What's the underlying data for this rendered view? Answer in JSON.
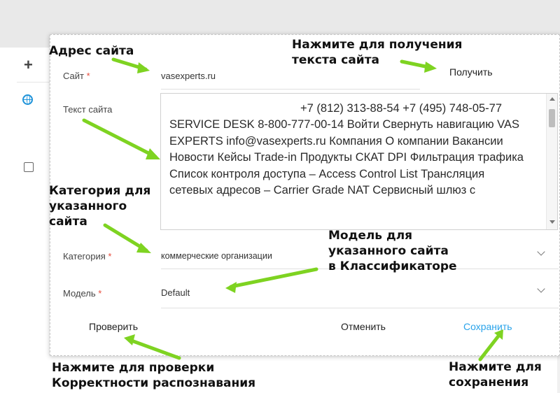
{
  "dialog": {
    "site_label": "Сайт",
    "site_value": "vasexperts.ru",
    "get_button": "Получить",
    "text_label": "Текст сайта",
    "text_content": "+7 (812) 313-88-54 +7 (495) 748-05-77 SERVICE DESK 8-800-777-00-14 Войти Свернуть навигацию VAS EXPERTS info@vasexperts.ru Компания О компании Вакансии Новости Кейсы Trade-in Продукты СКАТ DPI Фильтрация трафика Список контроля доступа – Access Control List Трансляция сетевых адресов – Carrier Grade NAT Сервисный шлюз с",
    "category_label": "Категория",
    "category_value": "коммерческие организации",
    "model_label": "Модель",
    "model_value": "Default",
    "required_mark": "*",
    "check_button": "Проверить",
    "cancel_button": "Отменить",
    "save_button": "Сохранить"
  },
  "annotations": {
    "site_address": "Адрес сайта",
    "get_text": "Нажмите для получения\nтекста сайта",
    "category": "Категория для\nуказанного\nсайта",
    "model": "Модель для\nуказанного сайта\nв Классификаторе",
    "check": "Нажмите для проверки\nКорректности распознавания",
    "save": "Нажмите для\nсохранения"
  },
  "colors": {
    "accent": "#1f93d9",
    "save": "#29a3ea",
    "arrow": "#7ed321",
    "required": "#e74c3c"
  },
  "icons": [
    "plus-icon",
    "globe-icon",
    "checkbox",
    "chevron-down-icon",
    "scroll-up-icon",
    "scroll-down-icon"
  ]
}
